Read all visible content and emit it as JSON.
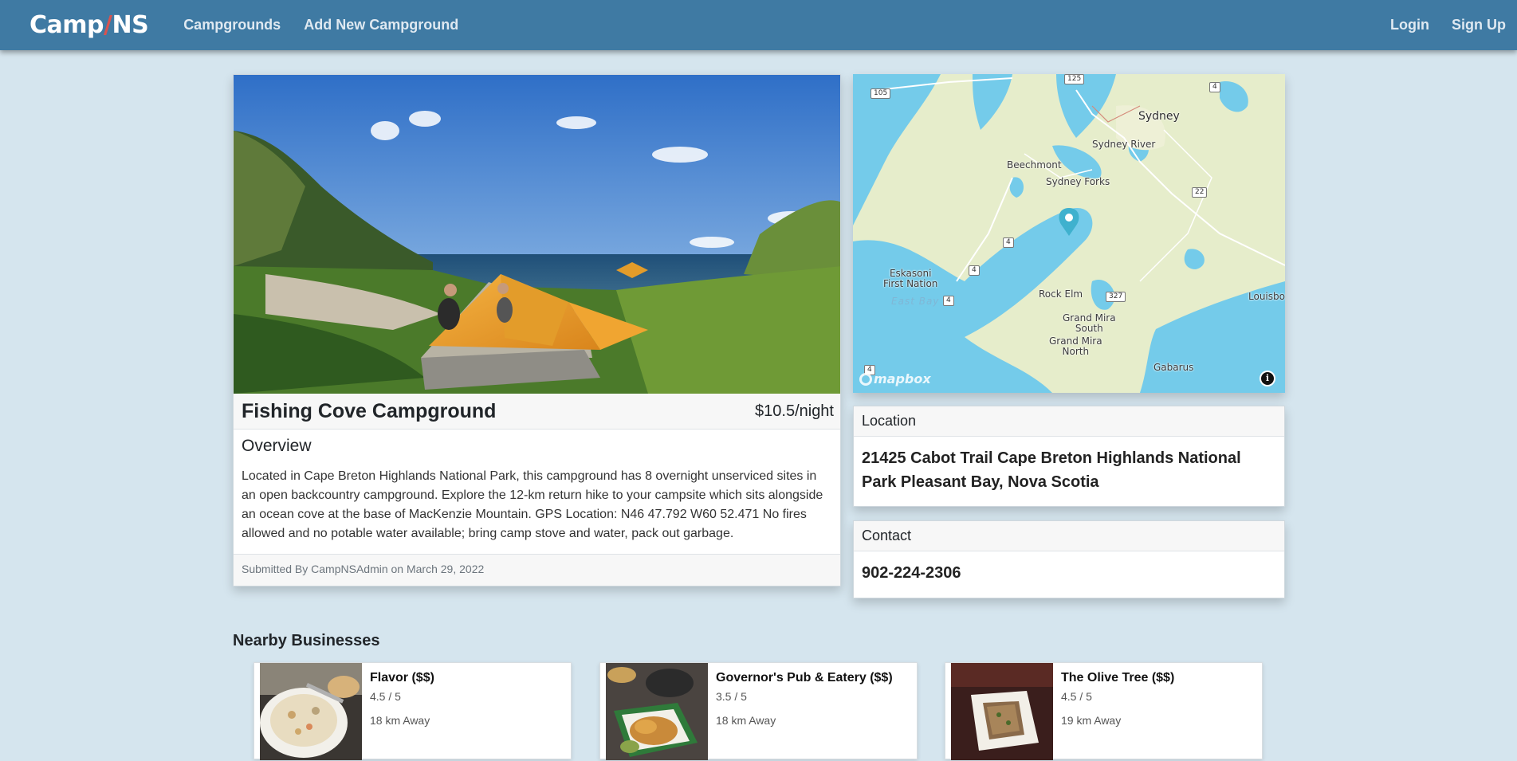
{
  "navbar": {
    "brand_left": "Camp",
    "brand_slash": "/",
    "brand_right": "NS",
    "links": [
      "Campgrounds",
      "Add New Campground"
    ],
    "login": "Login",
    "signup": "Sign Up"
  },
  "campground": {
    "title": "Fishing Cove Campground",
    "price": "$10.5/night",
    "overview_label": "Overview",
    "description": "Located in Cape Breton Highlands National Park, this campground has 8 overnight unserviced sites in an open backcountry campground. Explore the 12-km return hike to your campsite which sits alongside an ocean cove at the base of MacKenzie Mountain. GPS Location: N46 47.792 W60 52.471 No fires allowed and no potable water available; bring camp stove and water, pack out garbage.",
    "submitted_by": "Submitted By CampNSAdmin on March 29, 2022"
  },
  "map": {
    "labels": {
      "sydney": "Sydney",
      "sydney_river": "Sydney River",
      "beechmont": "Beechmont",
      "sydney_forks": "Sydney Forks",
      "eskasoni": "Eskasoni\nFirst Nation",
      "east_bay": "East Bay",
      "rock_elm": "Rock Elm",
      "grand_mira_south": "Grand Mira\nSouth",
      "grand_mira_north": "Grand Mira\nNorth",
      "gabarus": "Gabarus",
      "louisbourg": "Louisbo"
    },
    "road_shields": [
      "105",
      "125",
      "4",
      "22",
      "4",
      "4",
      "4",
      "327",
      "4"
    ],
    "attribution": "mapbox",
    "info_glyph": "i",
    "marker_color": "#3fb1ce"
  },
  "location": {
    "header": "Location",
    "address": "21425 Cabot Trail Cape Breton Highlands National Park Pleasant Bay, Nova Scotia"
  },
  "contact": {
    "header": "Contact",
    "phone": "902-224-2306"
  },
  "nearby": {
    "title": "Nearby Businesses",
    "businesses": [
      {
        "name": "Flavor ($$)",
        "rating": "4.5 / 5",
        "distance": "18 km Away"
      },
      {
        "name": "Governor's Pub & Eatery ($$)",
        "rating": "3.5 / 5",
        "distance": "18 km Away"
      },
      {
        "name": "The Olive Tree ($$)",
        "rating": "4.5 / 5",
        "distance": "19 km Away"
      }
    ]
  },
  "colors": {
    "navbar": "#3f7aa3",
    "page_bg": "#d5e5ee",
    "brand_slash": "#d9534f"
  }
}
